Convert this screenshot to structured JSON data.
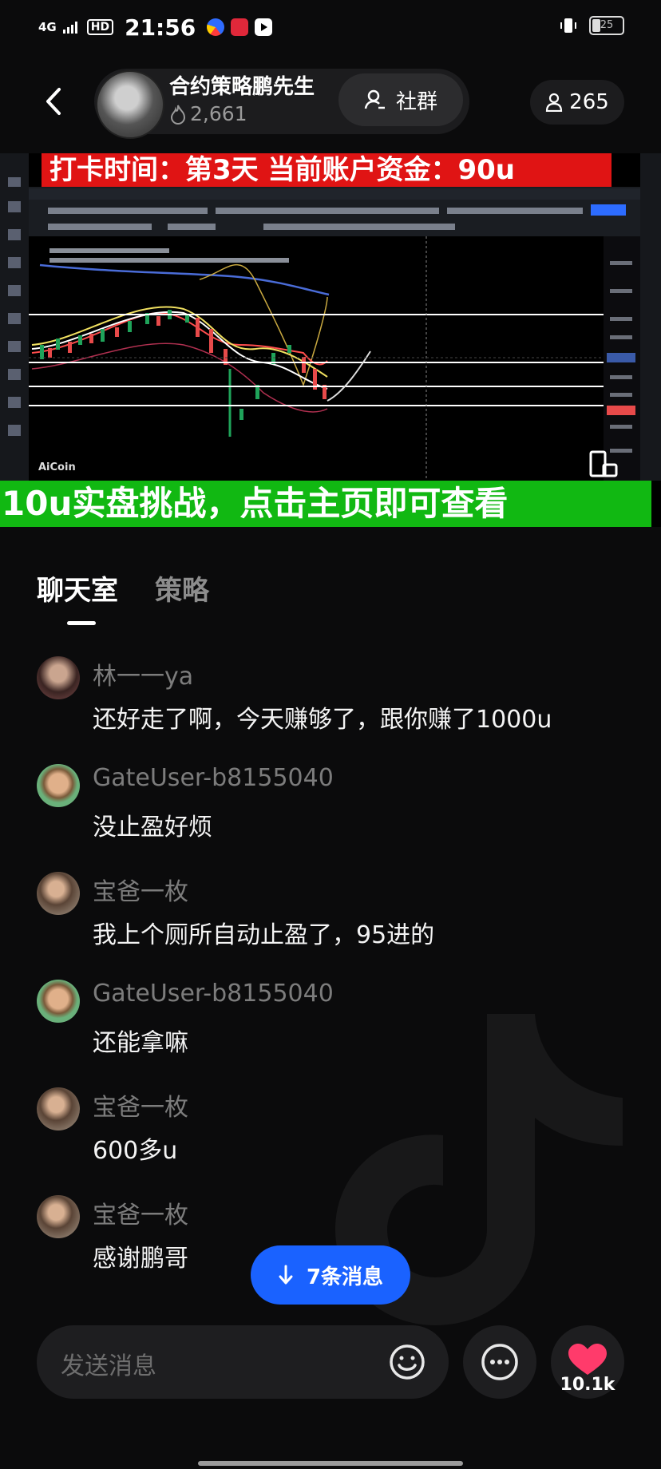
{
  "status_bar": {
    "network": "4G",
    "hd": "HD",
    "time": "21:56",
    "battery": "25"
  },
  "header": {
    "host_name": "合约策略鹏先生",
    "fans_count": "2,661",
    "community_label": "社群",
    "viewer_count": "265"
  },
  "video": {
    "banner_top": "打卡时间：第3天    当前账户资金：90u",
    "banner_bottom": "10u实盘挑战，点击主页即可查看",
    "logo": "AiCoin"
  },
  "tabs": [
    {
      "label": "聊天室",
      "active": true
    },
    {
      "label": "策略",
      "active": false
    }
  ],
  "messages": [
    {
      "user": "林一一ya",
      "text": "还好走了啊，今天赚够了，跟你赚了1000u",
      "avatar": "woman-avatar"
    },
    {
      "user": "GateUser-b8155040",
      "text": "没止盈好烦",
      "avatar": "smiling-man-avatar"
    },
    {
      "user": "宝爸一枚",
      "text": "我上个厕所自动止盈了，95进的",
      "avatar": "baby-father-avatar"
    },
    {
      "user": "GateUser-b8155040",
      "text": "还能拿嘛",
      "avatar": "smiling-man-avatar"
    },
    {
      "user": "宝爸一枚",
      "text": "600多u",
      "avatar": "baby-father-avatar"
    },
    {
      "user": "宝爸一枚",
      "text": "感谢鹏哥",
      "avatar": "baby-father-avatar"
    }
  ],
  "new_messages_label": "7条消息",
  "bottom_bar": {
    "input_placeholder": "发送消息",
    "like_count": "10.1k"
  },
  "colors": {
    "accent_blue": "#1a62ff",
    "banner_red": "#e01414",
    "banner_green": "#11b812",
    "like_pink": "#ff3b6b"
  }
}
